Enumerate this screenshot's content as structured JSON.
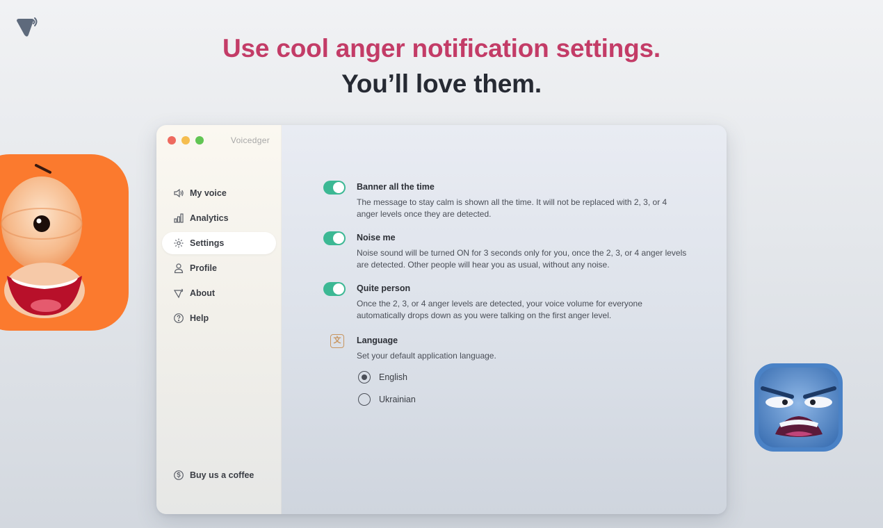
{
  "headline": {
    "line1": "Use cool anger notification settings.",
    "line2": "You’ll love them."
  },
  "app": {
    "name": "Voicedger"
  },
  "sidebar": {
    "items": [
      {
        "label": "My voice",
        "icon": "speaker-icon",
        "active": false
      },
      {
        "label": "Analytics",
        "icon": "bar-chart-icon",
        "active": false
      },
      {
        "label": "Settings",
        "icon": "gear-icon",
        "active": true
      },
      {
        "label": "Profile",
        "icon": "person-icon",
        "active": false
      },
      {
        "label": "About",
        "icon": "gem-icon",
        "active": false
      },
      {
        "label": "Help",
        "icon": "help-icon",
        "active": false
      }
    ],
    "bottom": {
      "label": "Buy us a coffee",
      "icon": "coin-icon"
    }
  },
  "settings": [
    {
      "title": "Banner all the time",
      "description": "The message to stay calm is shown all the time. It will not be replaced with 2, 3, or 4 anger levels once they are detected.",
      "enabled": true
    },
    {
      "title": "Noise me",
      "description": "Noise sound will be turned ON for 3 seconds only for you, once the 2, 3, or 4 anger levels are detected. Other people will hear you as usual, without any noise.",
      "enabled": true
    },
    {
      "title": "Quite person",
      "description": "Once the 2, 3, or 4 anger levels are detected, your voice volume for everyone automatically drops down as you were talking on the first anger level.",
      "enabled": true
    }
  ],
  "language": {
    "title": "Language",
    "description": "Set your default application language.",
    "options": [
      "English",
      "Ukrainian"
    ],
    "selected": "English"
  },
  "colors": {
    "accent_pink": "#c33c67",
    "toggle_green": "#3cb894",
    "emoji_left_bg": "#fb7a2e",
    "emoji_right_bg": "#4a82c6",
    "language_icon": "#c8955f"
  }
}
